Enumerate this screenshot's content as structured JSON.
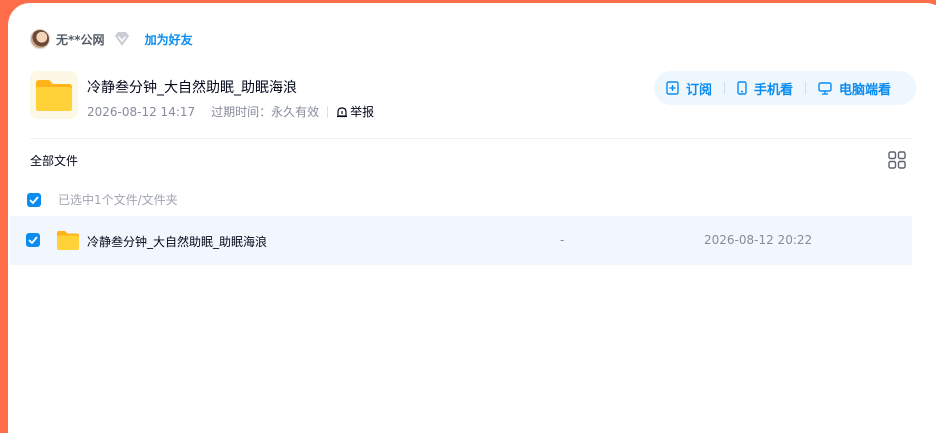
{
  "user": {
    "name": "无**公网",
    "add_friend_label": "加为好友"
  },
  "share": {
    "title": "冷静叁分钟_大自然助眠_助眠海浪",
    "created": "2026-08-12 14:17",
    "expire_label": "过期时间：",
    "expire_value": "永久有效",
    "report_label": "举报"
  },
  "actions": {
    "subscribe_label": "订阅",
    "mobile_label": "手机看",
    "pc_label": "电脑端看"
  },
  "breadcrumb": {
    "label": "全部文件"
  },
  "selection": {
    "text": "已选中1个文件/文件夹",
    "select_all_checked": true
  },
  "files": [
    {
      "name": "冷静叁分钟_大自然助眠_助眠海浪",
      "size": "-",
      "date": "2026-08-12 20:22",
      "checked": true,
      "icon": "folder-icon"
    }
  ],
  "colors": {
    "accent": "#0a8cf0",
    "background": "#fe6d4a",
    "row_selected": "#f1f7fd",
    "folder": "#ffc31f"
  }
}
